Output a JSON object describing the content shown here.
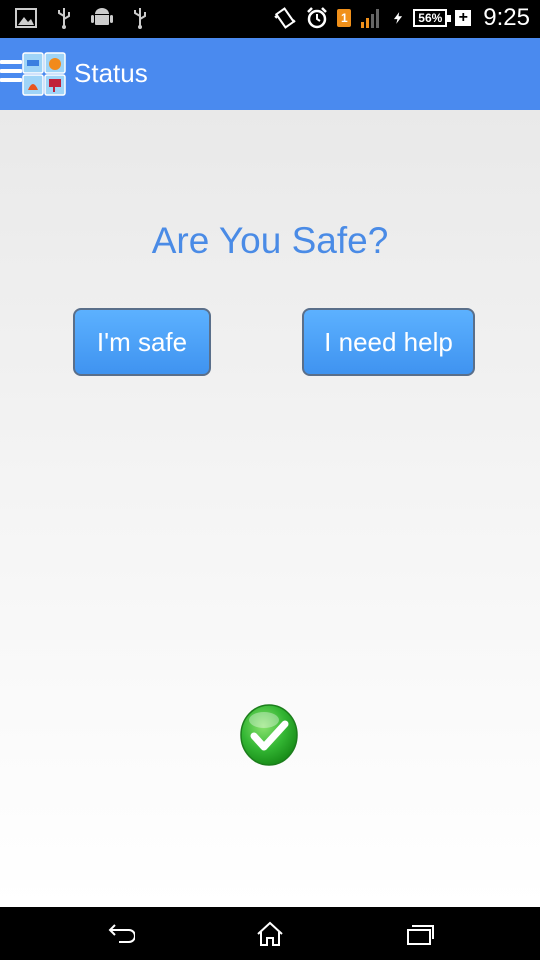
{
  "status_bar": {
    "battery_percent": "56%",
    "sim_label": "1",
    "time": "9:25",
    "left_icons": [
      "image-icon",
      "usb-icon",
      "android-icon",
      "usb-icon"
    ],
    "right_icons": [
      "vibrate-icon",
      "alarm-icon",
      "sim-icon",
      "signal-icon",
      "charging-icon",
      "battery-icon",
      "plus-icon"
    ]
  },
  "app_bar": {
    "title": "Status",
    "menu_icon": "hamburger-icon",
    "logo_icon": "app-logo-icon"
  },
  "main": {
    "question": "Are You Safe?",
    "safe_button_label": "I'm safe",
    "help_button_label": "I need help",
    "status_icon": "checkmark-icon"
  },
  "nav_bar": {
    "icons": [
      "back-icon",
      "home-icon",
      "recent-apps-icon"
    ]
  },
  "colors": {
    "app_bar": "#4a8aef",
    "question_text": "#4a8be6",
    "button": "#4a9ff5",
    "check_green": "#33b633"
  }
}
